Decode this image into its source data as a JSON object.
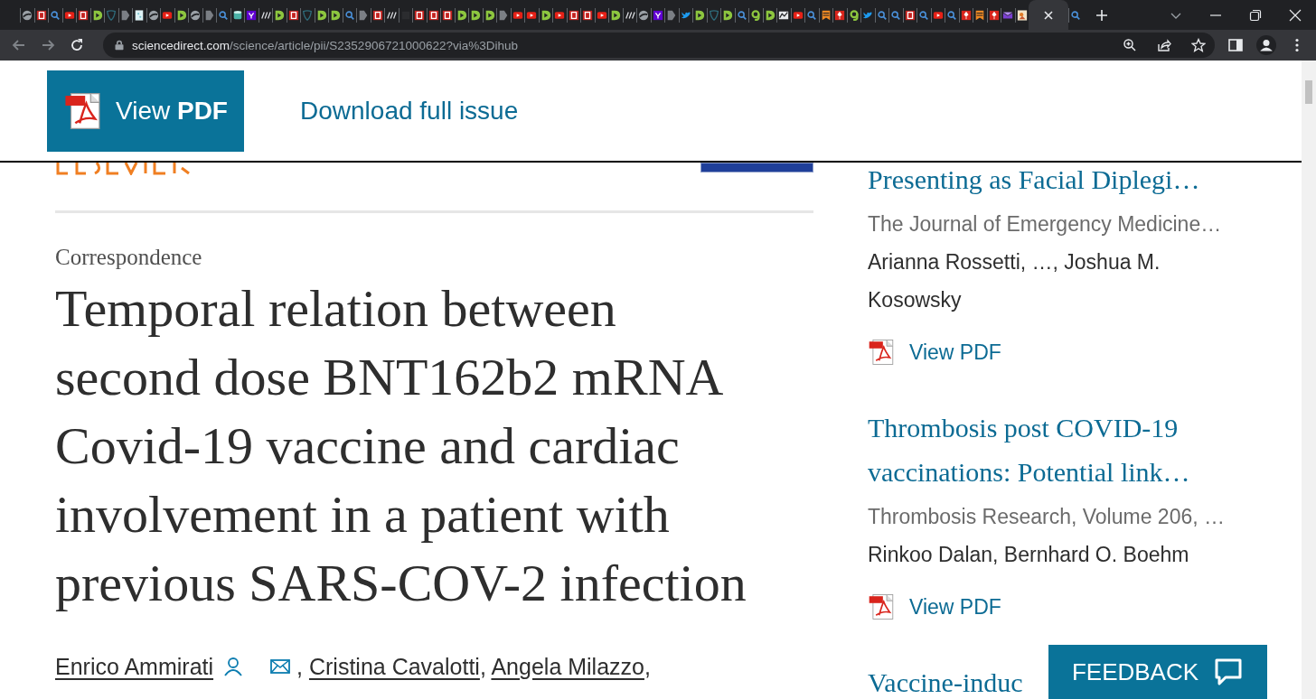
{
  "browser": {
    "tabs": [
      {
        "kind": "globe",
        "selected": false
      },
      {
        "kind": "b",
        "selected": false
      },
      {
        "kind": "search",
        "selected": false
      },
      {
        "kind": "yt",
        "selected": false
      },
      {
        "kind": "b",
        "selected": false
      },
      {
        "kind": "play",
        "selected": false
      },
      {
        "kind": "shield",
        "selected": false
      },
      {
        "kind": "chevron",
        "selected": false
      },
      {
        "kind": "doc",
        "selected": false
      },
      {
        "kind": "globe",
        "selected": false
      },
      {
        "kind": "yt",
        "selected": false
      },
      {
        "kind": "play",
        "selected": false
      },
      {
        "kind": "globe",
        "selected": false
      },
      {
        "kind": "chevron",
        "selected": false
      },
      {
        "kind": "search",
        "selected": false
      },
      {
        "kind": "db",
        "selected": false
      },
      {
        "kind": "yahoo",
        "selected": false
      },
      {
        "kind": "stripe",
        "selected": false
      },
      {
        "kind": "play",
        "selected": false
      },
      {
        "kind": "b",
        "selected": false
      },
      {
        "kind": "shield",
        "selected": false
      },
      {
        "kind": "play",
        "selected": false
      },
      {
        "kind": "play",
        "selected": false
      },
      {
        "kind": "search",
        "selected": false
      },
      {
        "kind": "chevron",
        "selected": false
      },
      {
        "kind": "b",
        "selected": false
      },
      {
        "kind": "stripe",
        "selected": false
      },
      {
        "kind": "dark",
        "selected": false
      },
      {
        "kind": "b",
        "selected": false
      },
      {
        "kind": "b",
        "selected": false
      },
      {
        "kind": "b",
        "selected": false
      },
      {
        "kind": "play",
        "selected": false
      },
      {
        "kind": "play",
        "selected": false
      },
      {
        "kind": "play",
        "selected": false
      },
      {
        "kind": "chevron",
        "selected": false
      },
      {
        "kind": "yt",
        "selected": false
      },
      {
        "kind": "yt",
        "selected": false
      },
      {
        "kind": "play",
        "selected": false
      },
      {
        "kind": "yt",
        "selected": false
      },
      {
        "kind": "b",
        "selected": false
      },
      {
        "kind": "b",
        "selected": false
      },
      {
        "kind": "yt",
        "selected": false
      },
      {
        "kind": "play",
        "selected": false
      },
      {
        "kind": "stripe",
        "selected": false
      },
      {
        "kind": "globe",
        "selected": false
      },
      {
        "kind": "yahoo",
        "selected": false
      },
      {
        "kind": "chevron",
        "selected": false
      },
      {
        "kind": "twitter",
        "selected": false
      },
      {
        "kind": "play",
        "selected": false
      },
      {
        "kind": "shield",
        "selected": false
      },
      {
        "kind": "play",
        "selected": false
      },
      {
        "kind": "search",
        "selected": false
      },
      {
        "kind": "g",
        "selected": false
      },
      {
        "kind": "play",
        "selected": false
      },
      {
        "kind": "chart",
        "selected": false
      },
      {
        "kind": "yt",
        "selected": false
      },
      {
        "kind": "search",
        "selected": false
      },
      {
        "kind": "bookmark",
        "selected": false
      },
      {
        "kind": "pin",
        "selected": false
      },
      {
        "kind": "g",
        "selected": false
      },
      {
        "kind": "twitter",
        "selected": false
      },
      {
        "kind": "search",
        "selected": false
      },
      {
        "kind": "search",
        "selected": false
      },
      {
        "kind": "b",
        "selected": false
      },
      {
        "kind": "search",
        "selected": false
      },
      {
        "kind": "yt",
        "selected": false
      },
      {
        "kind": "search",
        "selected": false
      },
      {
        "kind": "pin",
        "selected": false
      },
      {
        "kind": "bookmark",
        "selected": false
      },
      {
        "kind": "pin",
        "selected": false
      },
      {
        "kind": "mail",
        "selected": false
      },
      {
        "kind": "img",
        "selected": false
      },
      {
        "selected": true
      },
      {
        "kind": "search",
        "selected": false
      }
    ],
    "url_host": "sciencedirect.com",
    "url_path": "/science/article/pii/S2352906721000622?via%3Dihub"
  },
  "header": {
    "view_pdf": "View **PDF**",
    "download": "Download full issue"
  },
  "article": {
    "type": "Correspondence",
    "title_lines": [
      "Temporal relation between",
      "second dose BNT162b2 mRNA",
      "Covid-19 vaccine and cardiac",
      "involvement in a patient with",
      "previous SARS-COV-2 infection"
    ],
    "authors": [
      {
        "name": "Enrico Ammirati",
        "profile": true,
        "email": true,
        "suffix": ","
      },
      {
        "name": "Cristina Cavalotti",
        "profile": false,
        "email": false,
        "suffix": ","
      },
      {
        "name": "Angela Milazzo",
        "profile": false,
        "email": false,
        "suffix": ","
      }
    ]
  },
  "recommended": [
    {
      "title": "Presenting as Facial Diplegi…",
      "journal": "The Journal of Emergency Medicine…",
      "authors": "Arianna Rossetti, …, Joshua M. Kosowsky",
      "pdf": "View PDF"
    },
    {
      "title": "Thrombosis post COVID-19 vaccinations: Potential link…",
      "journal": "Thrombosis Research, Volume 206, …",
      "authors": "Rinkoo Dalan, Bernhard O. Boehm",
      "pdf": "View PDF"
    },
    {
      "title": "Vaccine-induc"
    }
  ],
  "feedback": "FEEDBACK"
}
